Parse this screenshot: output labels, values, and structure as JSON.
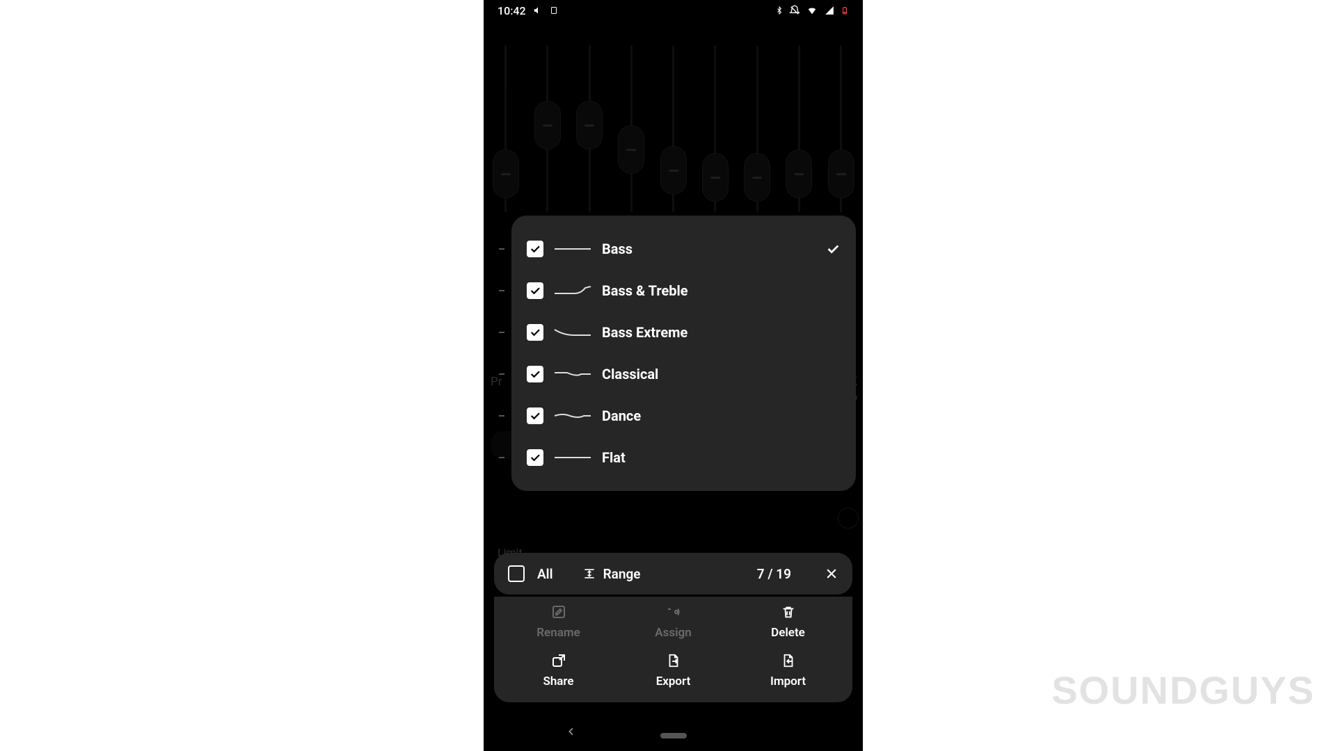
{
  "status": {
    "time": "10:42"
  },
  "background": {
    "p_text": "Pr",
    "k_text": "K",
    "o_text": "o",
    "limit_text": "Limit"
  },
  "presets": [
    {
      "name": "Bass",
      "checked": true,
      "selected": true,
      "curve": "flat"
    },
    {
      "name": "Bass & Treble",
      "checked": true,
      "selected": false,
      "curve": "bt"
    },
    {
      "name": "Bass Extreme",
      "checked": true,
      "selected": false,
      "curve": "down"
    },
    {
      "name": "Classical",
      "checked": true,
      "selected": false,
      "curve": "dip"
    },
    {
      "name": "Dance",
      "checked": true,
      "selected": false,
      "curve": "wavy"
    },
    {
      "name": "Flat",
      "checked": true,
      "selected": false,
      "curve": "flat"
    }
  ],
  "selection": {
    "all_label": "All",
    "range_label": "Range",
    "count": "7 / 19"
  },
  "actions": {
    "rename": "Rename",
    "assign": "Assign",
    "delete": "Delete",
    "share": "Share",
    "export": "Export",
    "import": "Import"
  },
  "watermark": "SOUNDGUYS"
}
